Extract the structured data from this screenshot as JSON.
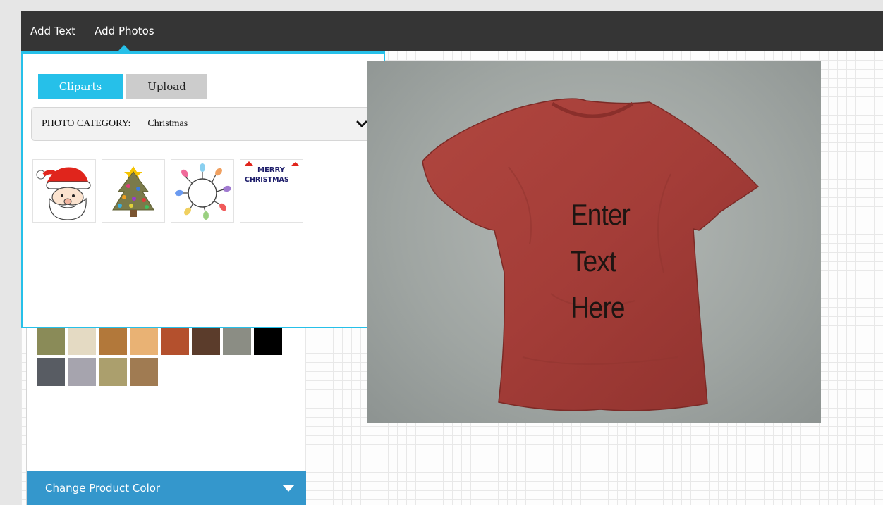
{
  "toolbar": {
    "tabs": [
      {
        "label": "Add Text",
        "active": false
      },
      {
        "label": "Add Photos",
        "active": true
      }
    ],
    "accent": "#26c0e9"
  },
  "photos_panel": {
    "buttons": {
      "cliparts": "Cliparts",
      "upload": "Upload"
    },
    "category": {
      "label": "PHOTO CATEGORY:",
      "value": "Christmas",
      "icon": "chevron-down-icon"
    },
    "cliparts": [
      {
        "name": "santa-clipart"
      },
      {
        "name": "christmas-tree-clipart"
      },
      {
        "name": "christmas-lights-clipart"
      },
      {
        "name": "merry-christmas-clipart",
        "text": [
          "MERRY",
          "CHRISTMAS"
        ]
      }
    ]
  },
  "product_colors": {
    "swatches": [
      "#8a8b58",
      "#e4dac3",
      "#b2783a",
      "#e9b274",
      "#b4502d",
      "#5b3c2b",
      "#8b8d84",
      "#000000",
      "#585c63",
      "#a6a4ae",
      "#ab9f6d",
      "#a07b52"
    ],
    "change_color_label": "Change Product Color"
  },
  "preview": {
    "shirt_color": "#a43d38",
    "text_lines": [
      "Enter",
      "Text",
      "Here"
    ]
  }
}
